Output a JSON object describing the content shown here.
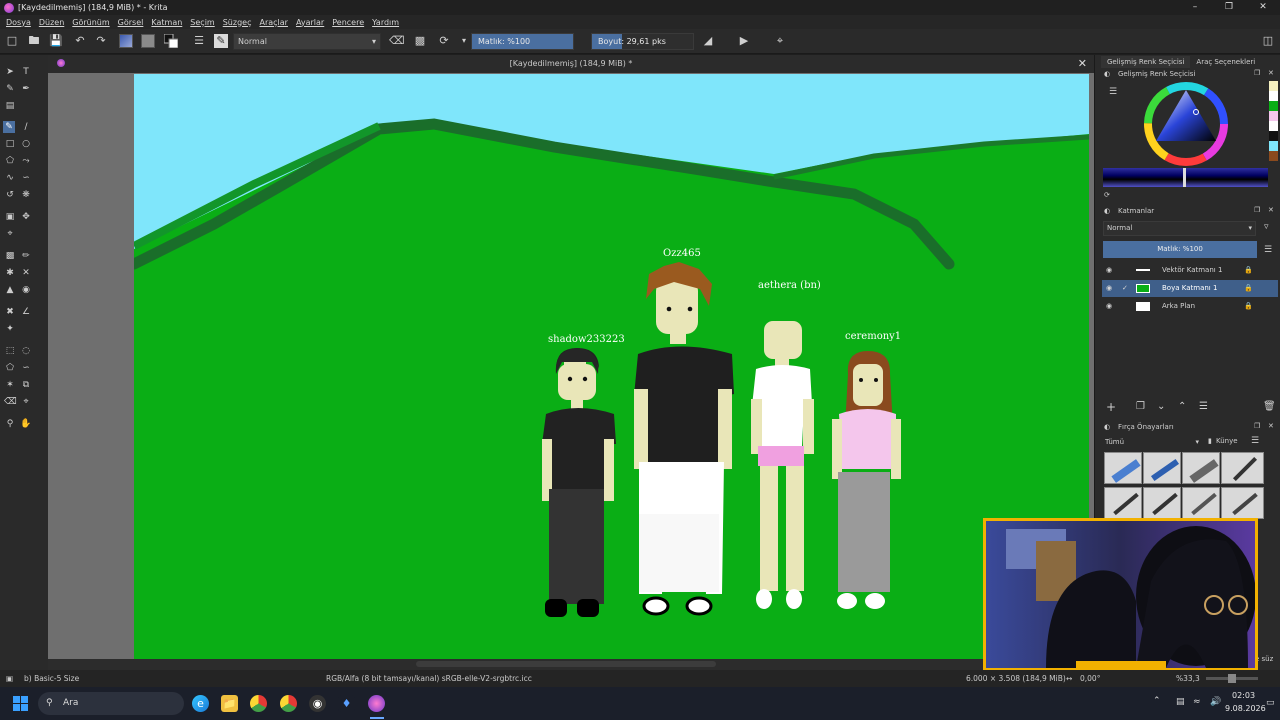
{
  "window": {
    "title": "[Kaydedilmemiş] (184,9 MiB) * - Krita"
  },
  "menu": [
    "Dosya",
    "Düzen",
    "Görünüm",
    "Görsel",
    "Katman",
    "Seçim",
    "Süzgeç",
    "Araçlar",
    "Ayarlar",
    "Pencere",
    "Yardım"
  ],
  "toolbar": {
    "blend_mode": "Normal",
    "opacity_label": "Matlık: %100",
    "opacity_fraction": 1.0,
    "size_label": "Boyut: 29,61 pks",
    "size_fraction": 0.3
  },
  "document": {
    "tab_title": "[Kaydedilmemiş]  (184,9 MiB) *"
  },
  "canvas": {
    "sky_color": "#7fe6fb",
    "grass_color": "#0aae15",
    "hill_outline_color": "#1a6e2a",
    "characters": [
      {
        "name": "Ozz465"
      },
      {
        "name": "aethera (bn)"
      },
      {
        "name": "shadow233223"
      },
      {
        "name": "ceremony1"
      }
    ]
  },
  "docker": {
    "tabs": [
      "Gelişmiş Renk Seçicisi",
      "Araç Seçenekleri"
    ],
    "color_selector_title": "Gelişmiş Renk Seçicisi",
    "layers_title": "Katmanlar",
    "layers_blend": "Normal",
    "layers_opacity": "Matlık: %100",
    "layers": [
      {
        "name": "Vektör Katmanı 1",
        "selected": false
      },
      {
        "name": "Boya Katmanı 1",
        "selected": true
      },
      {
        "name": "Arka Plan",
        "selected": false
      }
    ],
    "brush_presets_title": "Fırça Önayarları",
    "brush_filter": "Tümü",
    "brush_tag": "Künye",
    "brush_search_fragment": "e süz"
  },
  "status": {
    "brush": "b) Basic-5 Size",
    "color_space": "RGB/Alfa (8 bit tamsayı/kanal) sRGB-elle-V2-srgbtrc.icc",
    "dimensions": "6.000 × 3.508 (184,9 MiB)",
    "rotation": "0,00°",
    "zoom": "%33,3"
  },
  "taskbar": {
    "search": "Ara",
    "time": "02:03",
    "date": "9.08.2026"
  }
}
